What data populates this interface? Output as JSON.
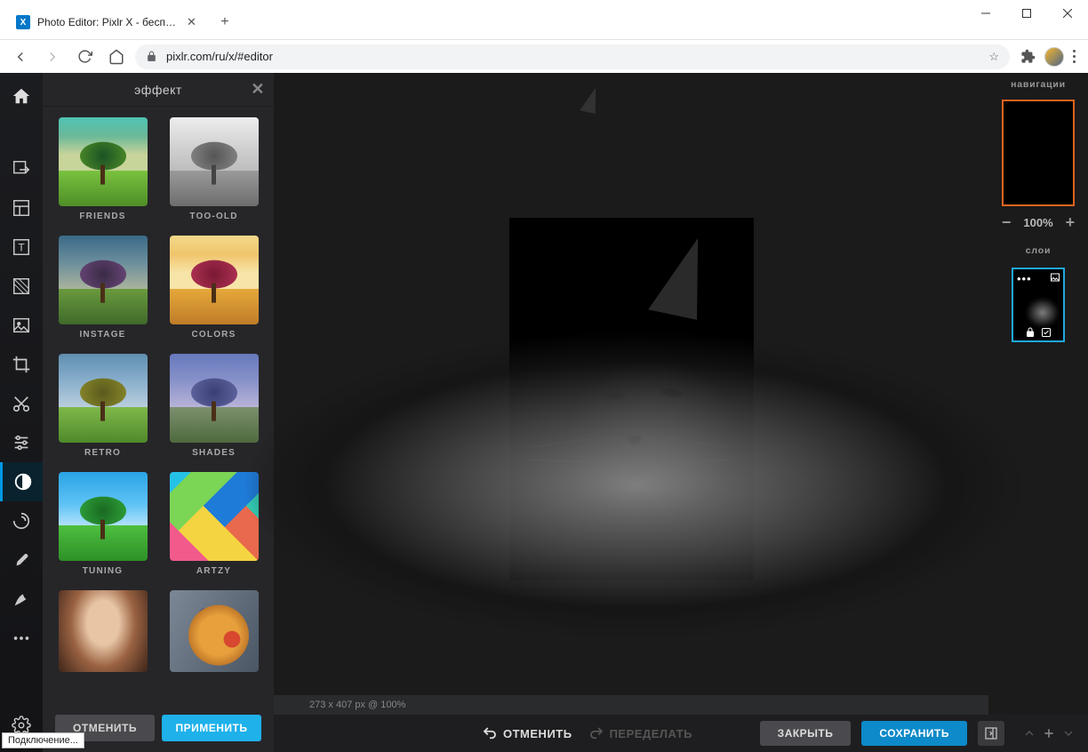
{
  "browser": {
    "tab_title": "Photo Editor: Pixlr X - бесплатны",
    "url": "pixlr.com/ru/x/#editor",
    "status_text": "Подключение..."
  },
  "panel": {
    "title": "эффект",
    "effects": [
      {
        "label": "FRIENDS"
      },
      {
        "label": "TOO-OLD"
      },
      {
        "label": "INSTAGE"
      },
      {
        "label": "COLORS"
      },
      {
        "label": "RETRO"
      },
      {
        "label": "SHADES"
      },
      {
        "label": "TUNING"
      },
      {
        "label": "ARTZY"
      }
    ],
    "cancel": "ОТМЕНИТЬ",
    "apply": "ПРИМЕНИТЬ"
  },
  "canvas": {
    "status": "273 x 407 px @ 100%"
  },
  "actions": {
    "undo": "ОТМЕНИТЬ",
    "redo": "ПЕРЕДЕЛАТЬ",
    "close": "ЗАКРЫТЬ",
    "save": "СОХРАНИТЬ"
  },
  "right": {
    "nav_title": "навигации",
    "zoom": "100%",
    "layers_title": "слои"
  }
}
